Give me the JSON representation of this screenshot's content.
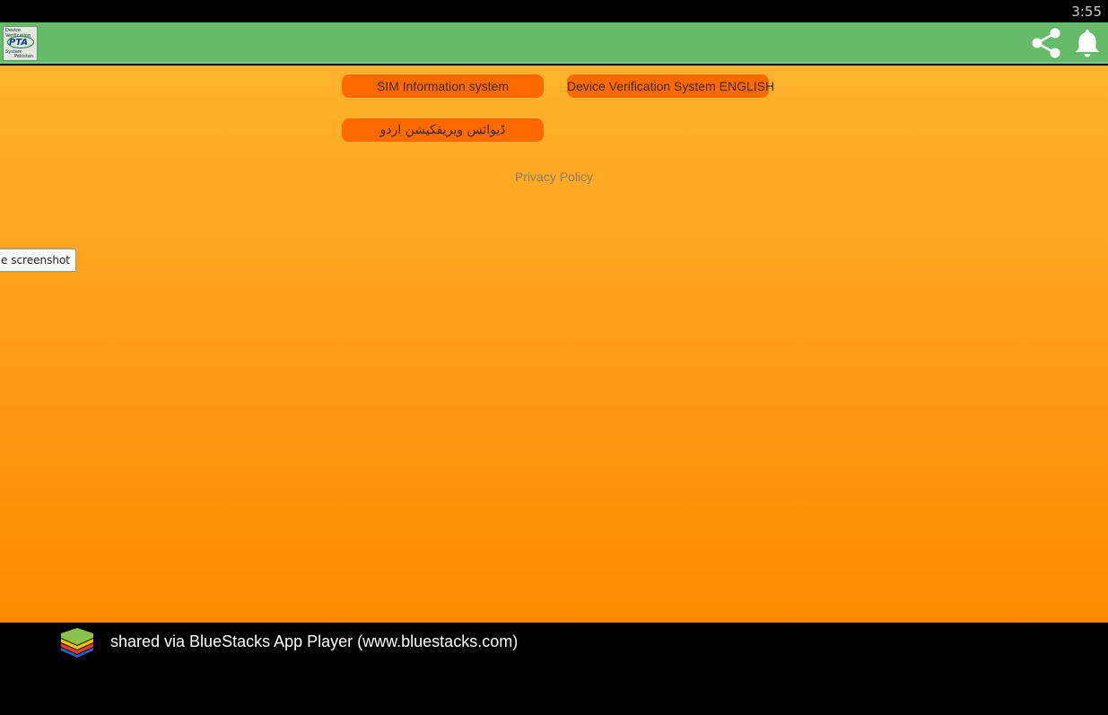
{
  "status_bar": {
    "time": "3:55"
  },
  "app_bar": {
    "logo": {
      "line1": "Device",
      "line2": "Verification",
      "brand": "PTA",
      "line3": "System",
      "line4": "Pakistan"
    },
    "share_icon": "share-icon",
    "bell_icon": "bell-icon"
  },
  "main": {
    "buttons": {
      "sim_info": "SIM Information system",
      "dvs_english": "Device Verification System ENGLISH",
      "dvs_urdu": "ڈیوائس ویریفکیشن اردو"
    },
    "privacy_policy": "Privacy Policy",
    "tooltip": "e screenshot"
  },
  "footer": {
    "text": "shared via BlueStacks App Player (www.bluestacks.com)"
  },
  "colors": {
    "app_bar": "#66bb6a",
    "button": "#ff6a00",
    "gradient_top": "#ffb32e",
    "gradient_bottom": "#ff8a00"
  }
}
